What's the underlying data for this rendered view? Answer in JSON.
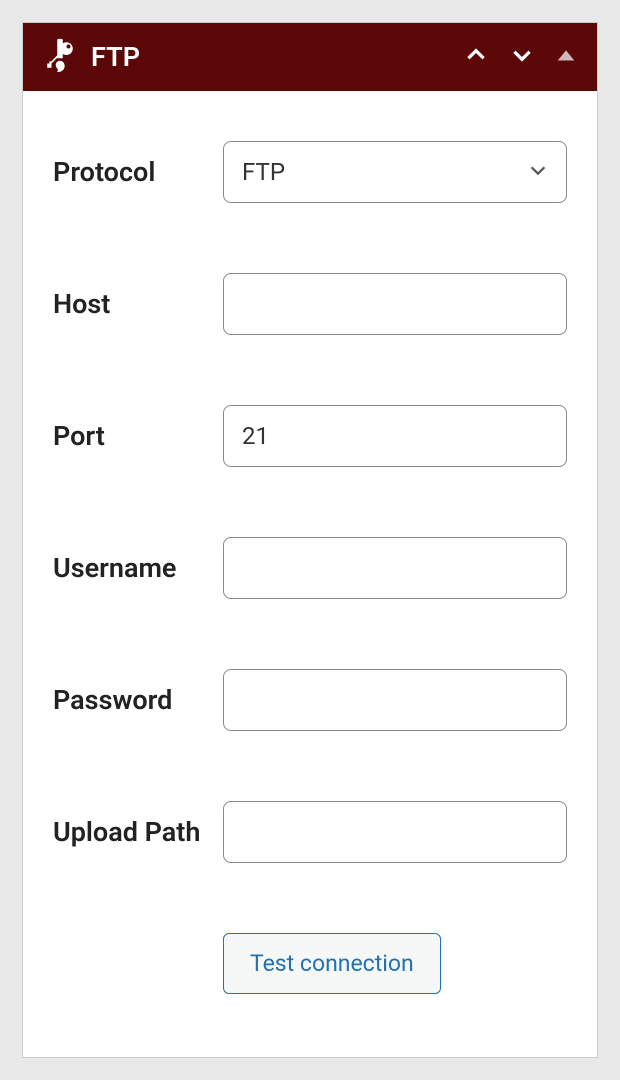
{
  "header": {
    "title": "FTP"
  },
  "form": {
    "protocol": {
      "label": "Protocol",
      "value": "FTP"
    },
    "host": {
      "label": "Host",
      "value": ""
    },
    "port": {
      "label": "Port",
      "value": "21"
    },
    "username": {
      "label": "Username",
      "value": ""
    },
    "password": {
      "label": "Password",
      "value": ""
    },
    "upload_path": {
      "label": "Upload Path",
      "value": ""
    },
    "test_button": "Test connection"
  }
}
